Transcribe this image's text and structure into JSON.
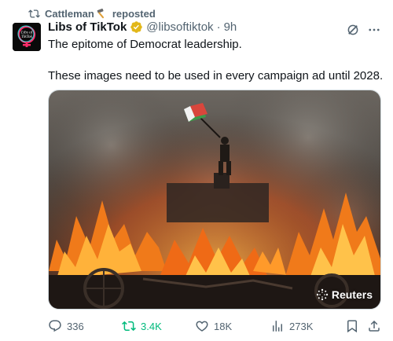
{
  "repost_bar": {
    "user": "Cattleman",
    "suffix": "reposted",
    "emoji": "hammer-icon"
  },
  "author": {
    "display_name": "Libs of TikTok",
    "handle": "@libsoftiktok",
    "separator": "·",
    "time": "9h",
    "verified": true,
    "avatar_text": "Libs of TikTok"
  },
  "tweet": {
    "line1": "The epitome of Democrat leadership.",
    "line2": "These images need to be used in every campaign ad until 2028."
  },
  "media": {
    "watermark": "Reuters"
  },
  "actions": {
    "replies": "336",
    "reposts": "3.4K",
    "likes": "18K",
    "views": "273K"
  },
  "colors": {
    "accent_repost": "#00ba7c",
    "muted": "#536471",
    "verified_gold": "#e2b719"
  }
}
